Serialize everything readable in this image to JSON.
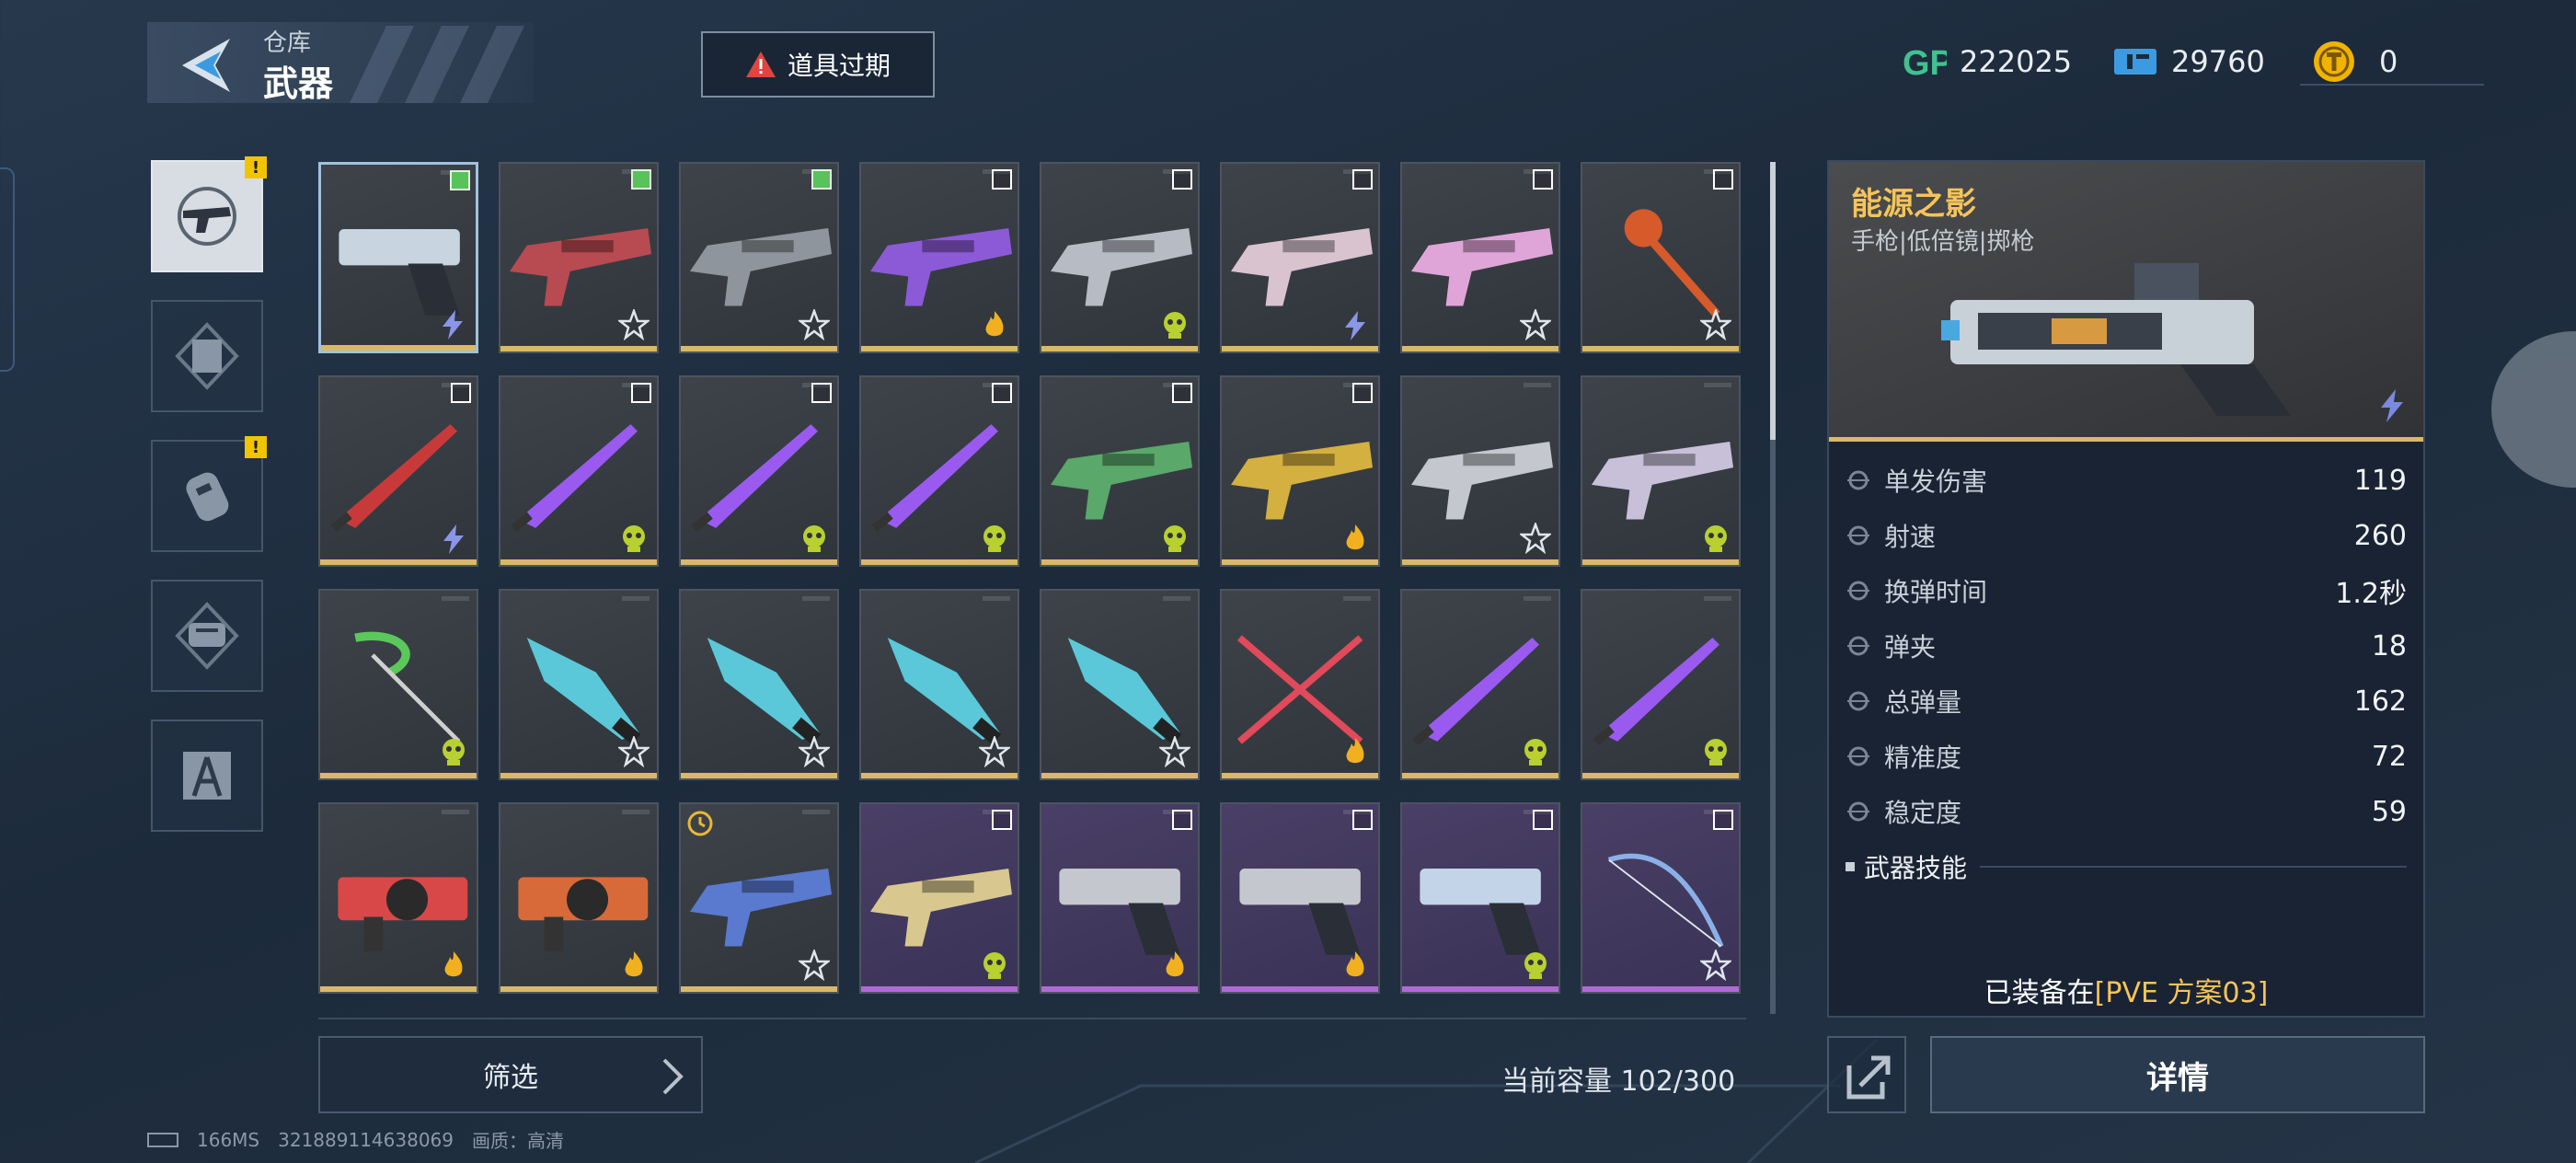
{
  "header": {
    "subtitle": "仓库",
    "title": "武器"
  },
  "expired_button": {
    "label": "道具过期"
  },
  "currencies": [
    {
      "icon": "gp-icon",
      "value": "222025",
      "color": "#3fc28f"
    },
    {
      "icon": "ticket-icon",
      "value": "29760",
      "color": "#3c9be0"
    },
    {
      "icon": "token-icon",
      "value": "0",
      "color": "#f0b400"
    }
  ],
  "categories": [
    {
      "icon": "pistol-icon",
      "active": true,
      "badge": "!"
    },
    {
      "icon": "armor-icon",
      "active": false,
      "badge": ""
    },
    {
      "icon": "grenade-icon",
      "active": false,
      "badge": "!"
    },
    {
      "icon": "fist-icon",
      "active": false,
      "badge": ""
    },
    {
      "icon": "compass-tool-icon",
      "active": false,
      "badge": ""
    }
  ],
  "weapons": [
    {
      "icon": "pistol-icon",
      "element": "lightning-icon",
      "checkbox": "checked",
      "selected": true,
      "rarity": "gold",
      "color": "#c8d4e0"
    },
    {
      "icon": "rifle-icon",
      "element": "star-icon",
      "checkbox": "checked",
      "rarity": "gold",
      "color": "#b84a52"
    },
    {
      "icon": "rifle-icon",
      "element": "star-icon",
      "checkbox": "checked",
      "rarity": "gold",
      "color": "#8e959c"
    },
    {
      "icon": "rifle-icon",
      "element": "fire-icon",
      "checkbox": "empty",
      "rarity": "gold",
      "color": "#8c5ad6"
    },
    {
      "icon": "rifle-icon",
      "element": "toxic-icon",
      "checkbox": "empty",
      "rarity": "gold",
      "color": "#b7bcc4"
    },
    {
      "icon": "rifle-icon",
      "element": "lightning-icon",
      "checkbox": "empty",
      "rarity": "gold",
      "color": "#d9c3cf"
    },
    {
      "icon": "rifle-icon",
      "element": "star-icon",
      "checkbox": "empty",
      "rarity": "gold",
      "color": "#e0a5d8"
    },
    {
      "icon": "staff-icon",
      "element": "star-icon",
      "checkbox": "empty",
      "rarity": "gold",
      "color": "#d65a2a"
    },
    {
      "icon": "blade-icon",
      "element": "lightning-icon",
      "checkbox": "empty",
      "rarity": "gold",
      "color": "#c83a3a"
    },
    {
      "icon": "blade-icon",
      "element": "toxic-icon",
      "checkbox": "empty",
      "rarity": "gold",
      "color": "#9a5af0"
    },
    {
      "icon": "blade-icon",
      "element": "toxic-icon",
      "checkbox": "empty",
      "rarity": "gold",
      "color": "#9a5af0"
    },
    {
      "icon": "blade-icon",
      "element": "toxic-icon",
      "checkbox": "empty",
      "rarity": "gold",
      "color": "#9a5af0"
    },
    {
      "icon": "rifle-icon",
      "element": "toxic-icon",
      "checkbox": "empty",
      "rarity": "gold",
      "color": "#5aa86a"
    },
    {
      "icon": "rifle-icon",
      "element": "fire-icon",
      "checkbox": "empty",
      "rarity": "gold",
      "color": "#d4b040"
    },
    {
      "icon": "rifle-icon",
      "element": "star-icon",
      "checkbox": "none",
      "rarity": "gold",
      "color": "#c4c8ce"
    },
    {
      "icon": "rifle-icon",
      "element": "toxic-icon",
      "checkbox": "none",
      "rarity": "gold",
      "color": "#c8c0d8"
    },
    {
      "icon": "scythe-icon",
      "element": "toxic-icon",
      "checkbox": "none",
      "rarity": "gold",
      "color": "#5ac85a"
    },
    {
      "icon": "knife-icon",
      "element": "star-icon",
      "checkbox": "none",
      "rarity": "gold",
      "color": "#5ac8d8"
    },
    {
      "icon": "knife-icon",
      "element": "star-icon",
      "checkbox": "none",
      "rarity": "gold",
      "color": "#5ac8d8"
    },
    {
      "icon": "knife-icon",
      "element": "star-icon",
      "checkbox": "none",
      "rarity": "gold",
      "color": "#5ac8d8"
    },
    {
      "icon": "knife-icon",
      "element": "star-icon",
      "checkbox": "none",
      "rarity": "gold",
      "color": "#5ac8d8"
    },
    {
      "icon": "crossed-swords-icon",
      "element": "fire-icon",
      "checkbox": "none",
      "rarity": "gold",
      "color": "#e04a5a"
    },
    {
      "icon": "blade-icon",
      "element": "toxic-icon",
      "checkbox": "none",
      "rarity": "gold",
      "color": "#9a5af0"
    },
    {
      "icon": "blade-icon",
      "element": "toxic-icon",
      "checkbox": "none",
      "rarity": "gold",
      "color": "#9a5af0"
    },
    {
      "icon": "launcher-icon",
      "element": "fire-icon",
      "checkbox": "none",
      "rarity": "gold",
      "color": "#d84848"
    },
    {
      "icon": "launcher-icon",
      "element": "fire-icon",
      "checkbox": "none",
      "rarity": "gold",
      "color": "#d86a3a"
    },
    {
      "icon": "rifle-icon",
      "element": "star-icon",
      "checkbox": "clock",
      "rarity": "gold",
      "color": "#5a7ad0"
    },
    {
      "icon": "rifle-icon",
      "element": "toxic-icon",
      "checkbox": "empty",
      "rarity": "purple",
      "color": "#d8c890"
    },
    {
      "icon": "pistol-icon",
      "element": "fire-icon",
      "checkbox": "empty",
      "rarity": "purple",
      "color": "#c4c8ce"
    },
    {
      "icon": "pistol-icon",
      "element": "fire-icon",
      "checkbox": "empty",
      "rarity": "purple",
      "color": "#c4c8ce"
    },
    {
      "icon": "pistol-icon",
      "element": "toxic-icon",
      "checkbox": "empty",
      "rarity": "purple",
      "color": "#c4d4e8"
    },
    {
      "icon": "bow-icon",
      "element": "star-icon",
      "checkbox": "empty",
      "rarity": "purple",
      "color": "#8ab0e8"
    }
  ],
  "filter": {
    "label": "筛选"
  },
  "capacity": {
    "text": "当前容量 102/300"
  },
  "detail": {
    "name": "能源之影",
    "type": "手枪|低倍镜|掷枪",
    "stats": [
      {
        "icon": "damage-icon",
        "label": "单发伤害",
        "value": "119"
      },
      {
        "icon": "fire-rate-icon",
        "label": "射速",
        "value": "260"
      },
      {
        "icon": "reload-icon",
        "label": "换弹时间",
        "value": "1.2秒"
      },
      {
        "icon": "magazine-icon",
        "label": "弹夹",
        "value": "18"
      },
      {
        "icon": "ammo-icon",
        "label": "总弹量",
        "value": "162"
      },
      {
        "icon": "accuracy-icon",
        "label": "精准度",
        "value": "72"
      },
      {
        "icon": "stability-icon",
        "label": "稳定度",
        "value": "59"
      }
    ],
    "skill_title": "武器技能",
    "equipped_prefix": "已装备在",
    "equipped_plan": "[PVE 方案03]"
  },
  "detail_button": {
    "label": "详情"
  },
  "status": {
    "ping": "166MS",
    "uid": "321889114638069",
    "quality": "画质：高清"
  }
}
